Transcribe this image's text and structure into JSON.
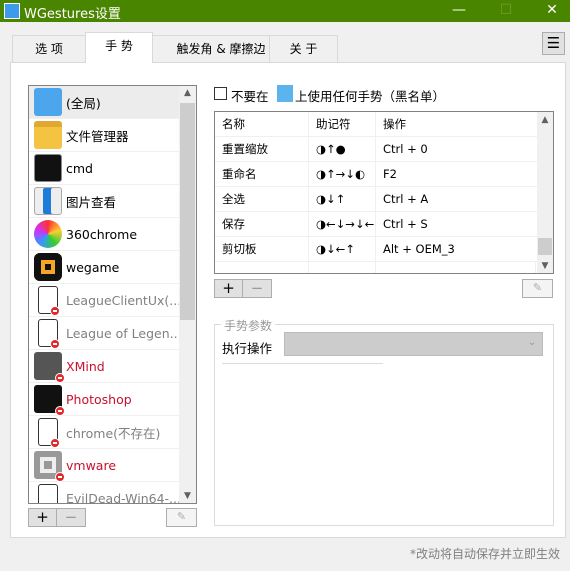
{
  "window": {
    "title": "WGestures设置",
    "minimize": "—",
    "maximize": "☐",
    "close": "✕"
  },
  "tabs": [
    {
      "label": "选 项"
    },
    {
      "label": "手 势"
    },
    {
      "label": "触发角 & 摩擦边"
    },
    {
      "label": "关 于"
    }
  ],
  "menu_icon": "☰",
  "apps": [
    {
      "label": "(全局)",
      "color": "#000000",
      "missing": false,
      "icon": "cursor-icon"
    },
    {
      "label": "文件管理器",
      "color": "#000000",
      "missing": false,
      "icon": "folder-icon"
    },
    {
      "label": "cmd",
      "color": "#000000",
      "missing": false,
      "icon": "terminal-icon"
    },
    {
      "label": "图片查看",
      "color": "#000000",
      "missing": false,
      "icon": "image-viewer-icon"
    },
    {
      "label": "360chrome",
      "color": "#000000",
      "missing": false,
      "icon": "360chrome-icon"
    },
    {
      "label": "wegame",
      "color": "#000000",
      "missing": false,
      "icon": "wegame-icon"
    },
    {
      "label": "LeagueClientUx(...",
      "color": "#808080",
      "missing": true,
      "icon": "unknown-file-icon"
    },
    {
      "label": "League of Legen...",
      "color": "#808080",
      "missing": true,
      "icon": "unknown-file-icon"
    },
    {
      "label": "XMind",
      "color": "#c8102e",
      "missing": true,
      "icon": "xmind-icon"
    },
    {
      "label": "Photoshop",
      "color": "#c8102e",
      "missing": true,
      "icon": "photoshop-icon"
    },
    {
      "label": "chrome(不存在)",
      "color": "#808080",
      "missing": true,
      "icon": "unknown-file-icon"
    },
    {
      "label": "vmware",
      "color": "#c8102e",
      "missing": true,
      "icon": "vmware-icon"
    },
    {
      "label": "EvilDead-Win64-...",
      "color": "#808080",
      "missing": true,
      "icon": "unknown-file-icon"
    }
  ],
  "list_buttons": {
    "add": "+",
    "remove": "−",
    "edit": "✎"
  },
  "blacklist": {
    "prefix": "不要在",
    "suffix": "上使用任何手势（黑名单）",
    "checked": false
  },
  "gestures": {
    "columns": [
      "名称",
      "助记符",
      "操作"
    ],
    "rows": [
      [
        "重置缩放",
        "◑↑●",
        "Ctrl + 0"
      ],
      [
        "重命名",
        "◑↑→↓◐",
        "F2"
      ],
      [
        "全选",
        "◑↓↑",
        "Ctrl + A"
      ],
      [
        "保存",
        "◑←↓→↓←",
        "Ctrl + S"
      ],
      [
        "剪切板",
        "◑↓←↑",
        "Alt + OEM_3"
      ]
    ]
  },
  "params": {
    "title": "手势参数",
    "action_label": "执行操作",
    "action_value": ""
  },
  "footer": "*改动将自动保存并立即生效",
  "colors": {
    "titlebar": "#4a8500",
    "missing_app": "#c8102e"
  }
}
